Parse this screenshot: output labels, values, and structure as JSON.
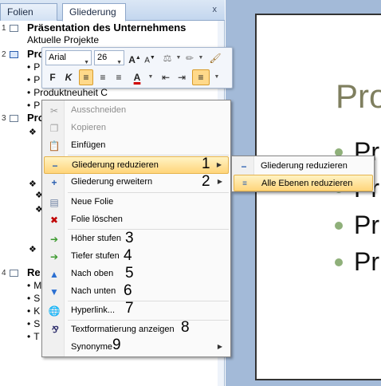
{
  "tabs": {
    "folien": "Folien",
    "gliederung": "Gliederung",
    "close": "x"
  },
  "outline": {
    "slide1": {
      "number": "1",
      "title": "Präsentation des Unternehmens",
      "subtitle": "Aktuelle Projekte"
    },
    "slide2": {
      "number": "2",
      "title_partial": "Pro",
      "bullets": [
        "P",
        "P",
        "Produktneuheit  C",
        "P"
      ]
    },
    "slide3": {
      "number": "3",
      "title_partial": "Pro"
    },
    "slide4": {
      "number": "4",
      "title_partial": "Re",
      "bullets": [
        "M",
        "S",
        "K",
        "S",
        "T"
      ]
    }
  },
  "mini_toolbar": {
    "font": "Arial",
    "size": "26",
    "grow": "A",
    "shrink": "A",
    "bold": "F",
    "italic": "K",
    "font_color": "A"
  },
  "slide": {
    "title_partial": "Pro",
    "bullets": [
      "Pr",
      "Pr",
      "Pr",
      "Pr"
    ]
  },
  "context_menu": {
    "items": [
      {
        "label": "Ausschneiden",
        "disabled": true
      },
      {
        "label": "Kopieren",
        "disabled": true
      },
      {
        "label": "Einfügen",
        "disabled": false
      },
      {
        "label": "Gliederung reduzieren",
        "disabled": false,
        "number": "1"
      },
      {
        "label": "Gliederung erweitern",
        "disabled": false,
        "number": "2"
      },
      {
        "label": "Neue Folie",
        "disabled": false
      },
      {
        "label": "Folie löschen",
        "disabled": false
      },
      {
        "label": "Höher stufen",
        "disabled": false,
        "number": "3"
      },
      {
        "label": "Tiefer stufen",
        "disabled": false,
        "number": "4"
      },
      {
        "label": "Nach oben",
        "disabled": false,
        "number": "5"
      },
      {
        "label": "Nach unten",
        "disabled": false,
        "number": "6"
      },
      {
        "label": "Hyperlink...",
        "disabled": false,
        "number": "7"
      },
      {
        "label": "Textformatierung anzeigen",
        "disabled": false,
        "number": "8"
      },
      {
        "label": "Synonyme",
        "disabled": false,
        "number": "9"
      }
    ]
  },
  "submenu": {
    "items": [
      {
        "label": "Gliederung reduzieren"
      },
      {
        "label": "Alle Ebenen reduzieren"
      }
    ]
  },
  "colors": {
    "highlight": "#ffd57a",
    "slide_bg": "#a3bad8",
    "bullet_dot": "#8fb07a",
    "title_color": "#7f7f5f"
  }
}
